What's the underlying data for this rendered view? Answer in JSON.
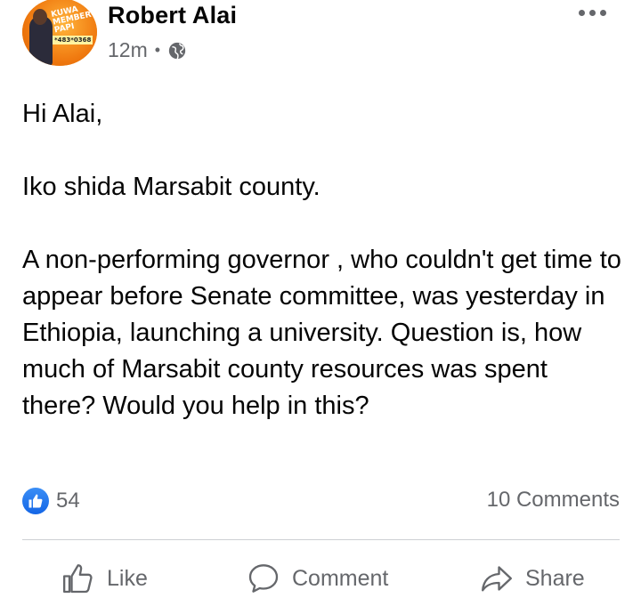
{
  "post": {
    "author": "Robert Alai",
    "time": "12m",
    "separator": "•",
    "avatar_text": "KUWA MEMBER PAPI",
    "avatar_phone": "*483*0368",
    "body": {
      "greeting": "Hi Alai,",
      "line2": "Iko shida Marsabit county.",
      "paragraph": "A non-performing governor , who couldn't get time to appear before Senate committee, was yesterday  in Ethiopia, launching a university. Question is, how much of Marsabit county resources was spent there? Would you help in this?"
    },
    "reactions_count": "54",
    "comments_label": "10 Comments"
  },
  "actions": {
    "like": "Like",
    "comment": "Comment",
    "share": "Share"
  },
  "colors": {
    "text": "#050505",
    "secondary": "#65676b",
    "like_blue": "#1877f2",
    "divider": "#ced0d4"
  },
  "icons": [
    "globe-icon",
    "more-options-icon",
    "like-reaction-icon",
    "thumbs-up-icon",
    "comment-icon",
    "share-icon"
  ]
}
